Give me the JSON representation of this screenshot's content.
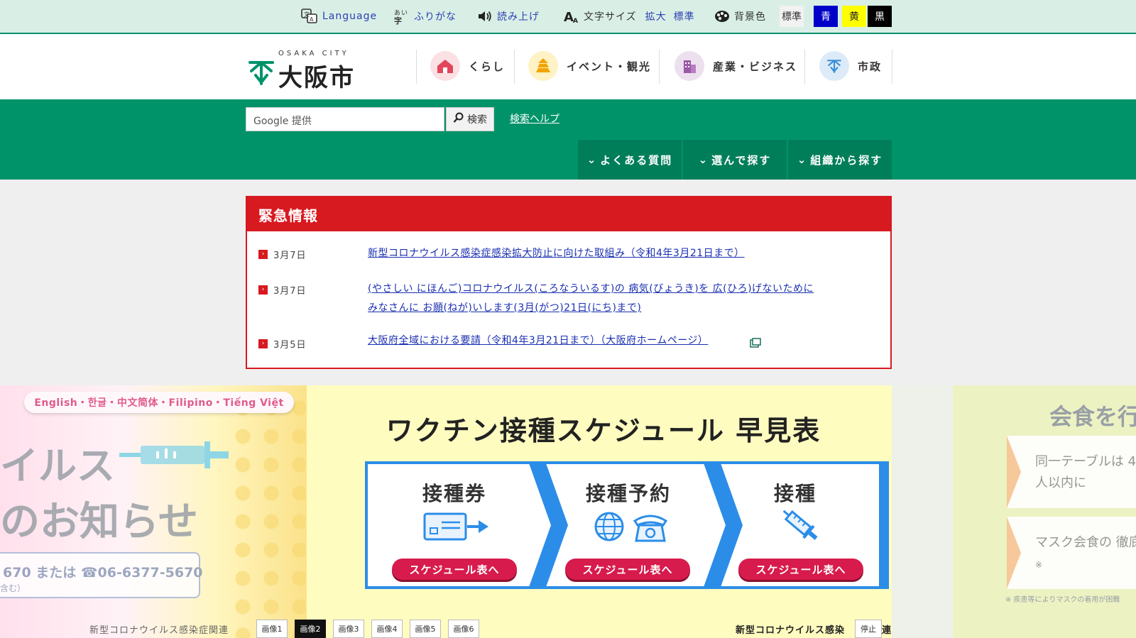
{
  "utility": {
    "language": "Language",
    "furigana": "ふりがな",
    "readaloud": "読み上げ",
    "fontsize_label": "文字サイズ",
    "fontsize_large": "拡大",
    "fontsize_std": "標準",
    "bgcolor_label": "背景色",
    "bg_std": "標準",
    "bg_blue": "青",
    "bg_yellow": "黄",
    "bg_black": "黒",
    "colors": {
      "blue": "#0000c8",
      "yellow": "#ffff00",
      "black": "#000000"
    }
  },
  "header": {
    "logo_en": "OSAKA CITY",
    "logo_jp": "大阪市",
    "nav": [
      {
        "label": "くらし",
        "icon": "house-icon"
      },
      {
        "label": "イベント・観光",
        "icon": "pagoda-icon"
      },
      {
        "label": "産業・ビジネス",
        "icon": "building-icon"
      },
      {
        "label": "市政",
        "icon": "city-emblem-icon"
      }
    ]
  },
  "search": {
    "placeholder": "Google 提供",
    "button": "検索",
    "help": "検索ヘルプ",
    "subnav": [
      "よくある質問",
      "選んで探す",
      "組織から探す"
    ]
  },
  "emergency": {
    "title": "緊急情報",
    "items": [
      {
        "date": "3月7日",
        "text": "新型コロナウイルス感染症感染拡大防止に向けた取組み（令和4年3月21日まで）",
        "text2": ""
      },
      {
        "date": "3月7日",
        "text": "(やさしい にほんご)コロナウイルス(ころなういるす)の 病気(びょうき)を 広(ひろ)げないために",
        "text2": "みなさんに お願(ねが)いします(3月(がつ)21日(にち)まで)"
      },
      {
        "date": "3月5日",
        "text": "大阪府全域における要請（令和4年3月21日まで）（大阪府ホームページ）",
        "text2": ""
      }
    ]
  },
  "slider": {
    "left_langs": "English・한글・中文简体・Filipino・Tiếng Việt",
    "left_big1": "イルス",
    "left_big2": "のお知らせ",
    "left_phone": "670 または ☎06-6377-5670",
    "left_phone2": "含む）",
    "main_title": "ワクチン接種スケジュール 早見表",
    "steps": [
      {
        "title": "接種券",
        "button": "スケジュール表へ"
      },
      {
        "title": "接種予約",
        "button": "スケジュール表へ"
      },
      {
        "title": "接種",
        "button": "スケジュール表へ"
      }
    ],
    "right_title": "会食を行",
    "right_card1": "同一テーブルは 4人以内に",
    "right_card2": "マスク会食の 徹底",
    "right_card2_mark": "※",
    "right_note": "※ 疾患等によりマスクの着用が困難",
    "caption_left": "新型コロナウイルス感染症関連",
    "caption_right": "新型コロナウイルス感染",
    "caption_right_tail": "連",
    "tabs": [
      "画像1",
      "画像2",
      "画像3",
      "画像4",
      "画像5",
      "画像6"
    ],
    "active_tab": 1,
    "pause": "停止"
  }
}
